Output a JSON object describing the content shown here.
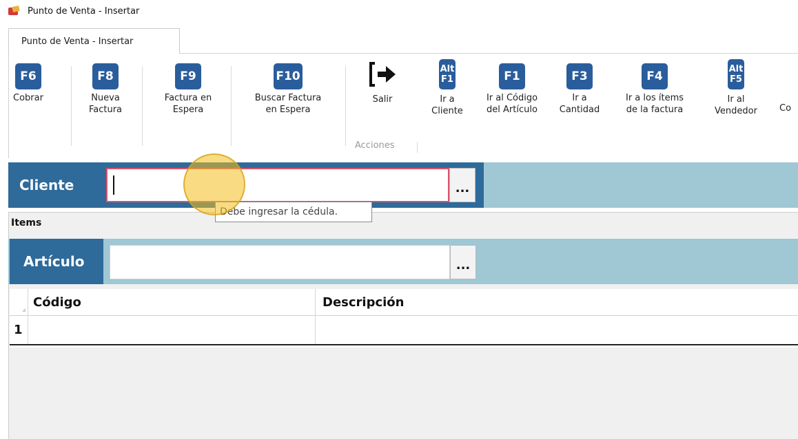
{
  "window": {
    "title": "Punto de Venta - Insertar"
  },
  "tab": {
    "label": "Punto de Venta - Insertar"
  },
  "ribbon": {
    "buttons": [
      {
        "key": "F6",
        "label1": "Cobrar",
        "label2": ""
      },
      {
        "key": "F8",
        "label1": "Nueva",
        "label2": "Factura"
      },
      {
        "key": "F9",
        "label1": "Factura en",
        "label2": "Espera"
      },
      {
        "key": "F10",
        "label1": "Buscar Factura",
        "label2": "en Espera"
      },
      {
        "key": "",
        "label1": "Salir",
        "label2": ""
      },
      {
        "key_top": "Alt",
        "key_bottom": "F1",
        "label1": "Ir a",
        "label2": "Cliente"
      },
      {
        "key": "F1",
        "label1": "Ir al Código",
        "label2": "del Artículo"
      },
      {
        "key": "F3",
        "label1": "Ir a",
        "label2": "Cantidad"
      },
      {
        "key": "F4",
        "label1": "Ir a los ítems",
        "label2": "de la factura"
      },
      {
        "key_top": "Alt",
        "key_bottom": "F5",
        "label1": "Ir al",
        "label2": "Vendedor"
      },
      {
        "key": "",
        "label1": "Co",
        "label2": ""
      }
    ],
    "group_label": "Acciones"
  },
  "cliente": {
    "label": "Cliente",
    "value": "",
    "lookup_label": "...",
    "tooltip": "Debe ingresar la cédula."
  },
  "items": {
    "title": "Items",
    "articulo": {
      "label": "Artículo",
      "value": "",
      "lookup_label": "..."
    },
    "columns": [
      "Código",
      "Descripción"
    ],
    "rows": [
      {
        "num": "1",
        "codigo": "",
        "descripcion": ""
      }
    ]
  },
  "colors": {
    "accent": "#2e6a9a",
    "panel": "#9fc7d4",
    "key": "#2a5d9c",
    "error_border": "#d9546b",
    "cursor": "#f2be1e"
  }
}
